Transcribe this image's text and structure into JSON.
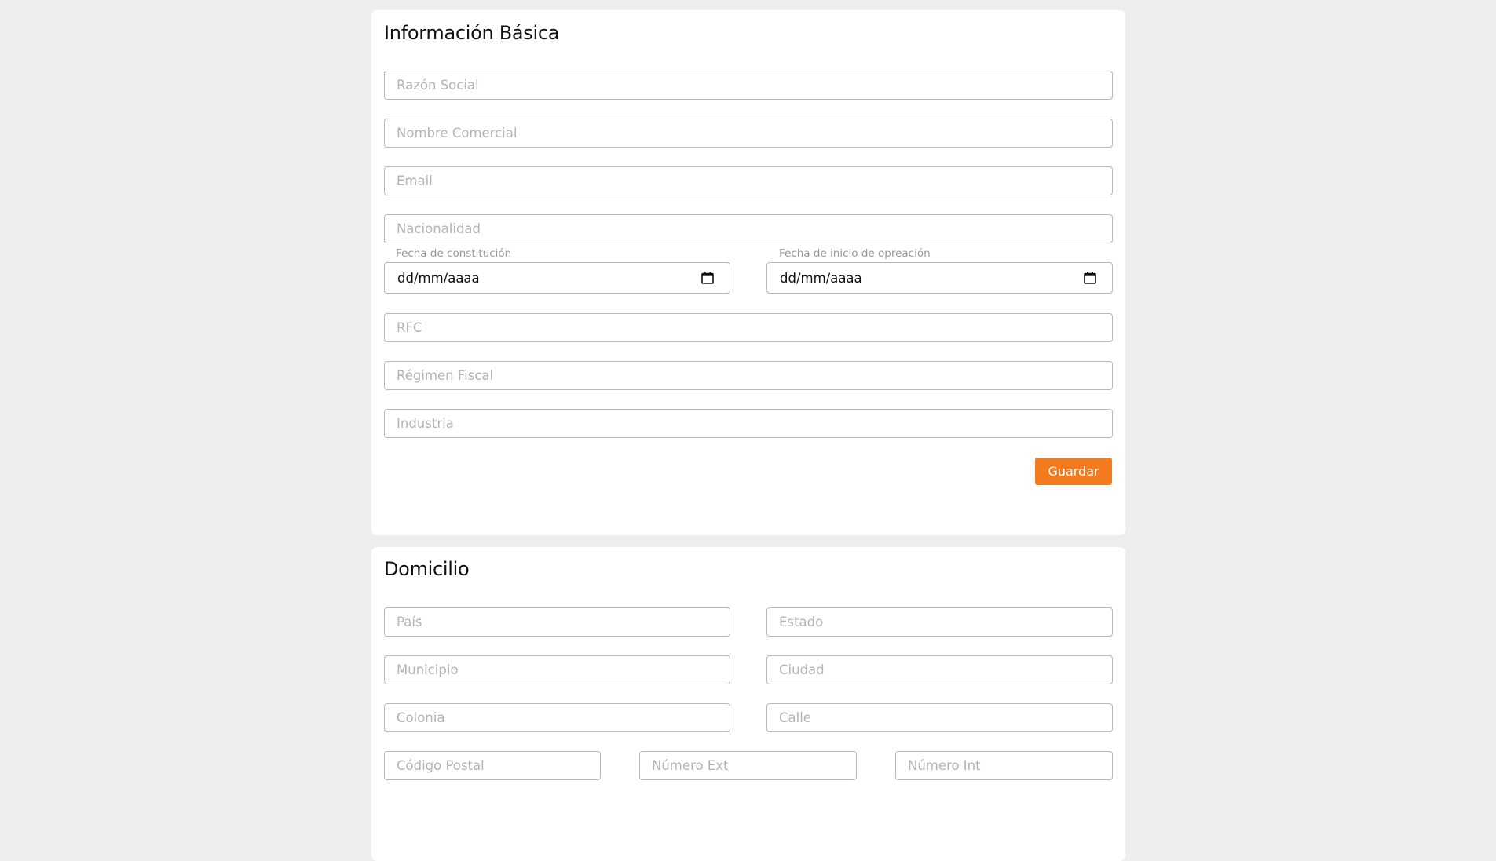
{
  "basic_info": {
    "title": "Información Básica",
    "razon_social_placeholder": "Razón Social",
    "nombre_comercial_placeholder": "Nombre Comercial",
    "email_placeholder": "Email",
    "nacionalidad_placeholder": "Nacionalidad",
    "fecha_constitucion_label": "Fecha de constitución",
    "fecha_constitucion_value": "dd/mm/aaaa",
    "fecha_inicio_label": "Fecha de inicio de opreación",
    "fecha_inicio_value": "dd/mm/aaaa",
    "rfc_placeholder": "RFC",
    "regimen_fiscal_placeholder": "Régimen Fiscal",
    "industria_placeholder": "Industria",
    "save_label": "Guardar",
    "save_color": "#f47a1f"
  },
  "address": {
    "title": "Domicilio",
    "pais_placeholder": "País",
    "estado_placeholder": "Estado",
    "municipio_placeholder": "Municipio",
    "ciudad_placeholder": "Ciudad",
    "colonia_placeholder": "Colonia",
    "calle_placeholder": "Calle",
    "codigo_postal_placeholder": "Código Postal",
    "numero_ext_placeholder": "Número Ext",
    "numero_int_placeholder": "Número Int"
  },
  "icons": {
    "date_picker": "calendar-icon"
  }
}
